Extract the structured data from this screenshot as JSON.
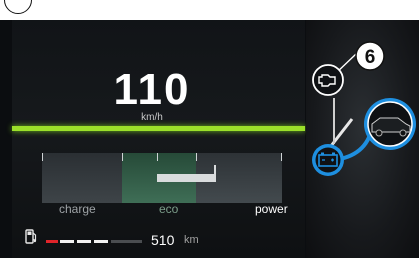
{
  "speed": {
    "value": "110",
    "unit": "km/h"
  },
  "mode_gauge": {
    "segments": [
      "charge",
      "eco",
      "power"
    ],
    "active_segment": "eco"
  },
  "range": {
    "value": "510",
    "unit": "km"
  },
  "callout": {
    "number": "6"
  },
  "icons": {
    "top_corner": "circle-marker-icon",
    "fuel": "fuel-pump-icon",
    "engine": "engine-check-icon",
    "car": "car-icon",
    "battery": "battery-icon"
  },
  "colors": {
    "accent_green": "#9be02a",
    "accent_blue": "#1e8fe0",
    "fuel_red": "#e0242a"
  }
}
